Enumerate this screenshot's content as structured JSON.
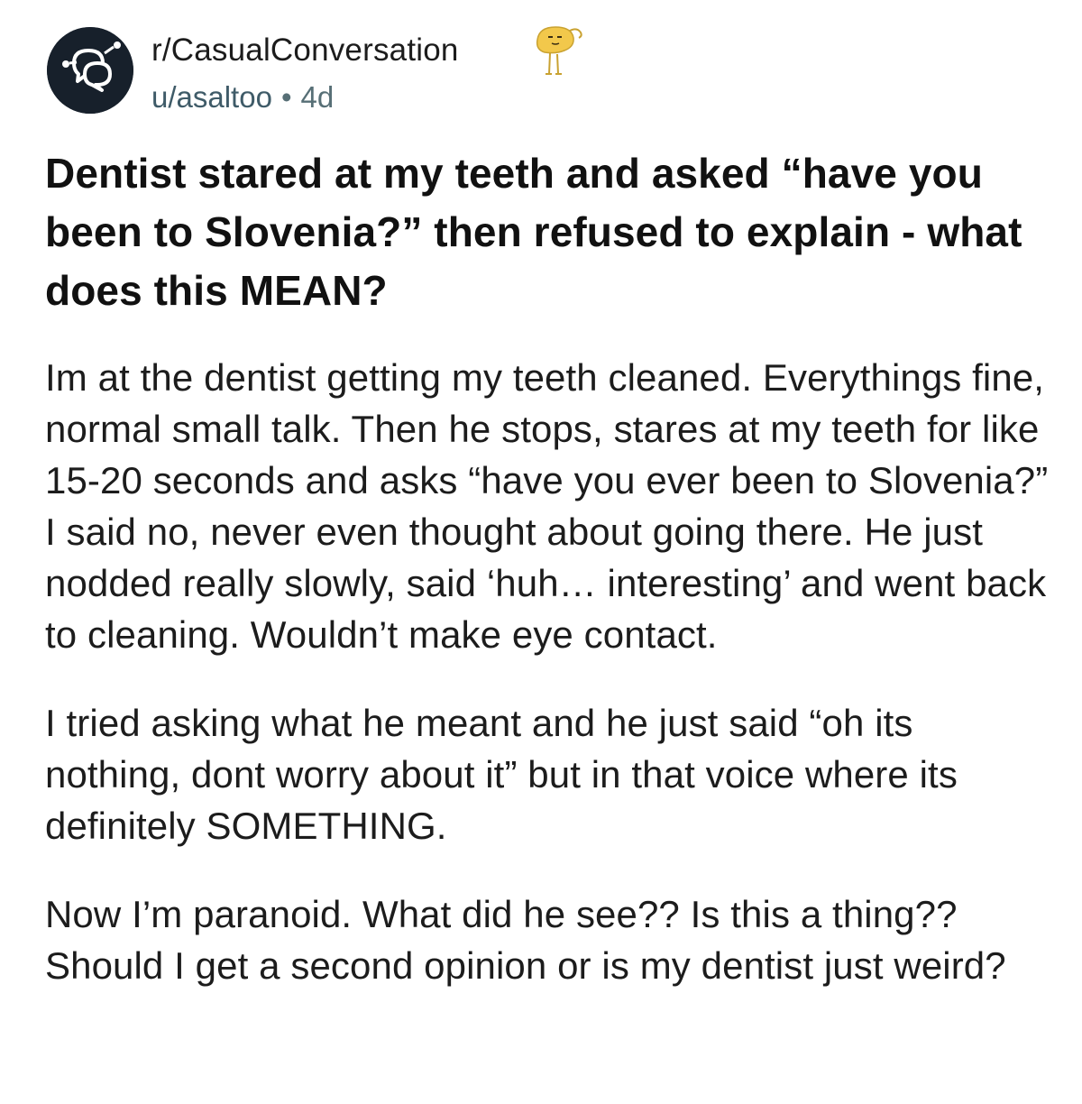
{
  "post": {
    "subreddit": "r/CasualConversation",
    "author": "u/asaltoo",
    "separator": "•",
    "age": "4d",
    "subreddit_icon": "speech-bubbles-icon",
    "award_icon": "award-mascot-icon",
    "title": "Dentist stared at my teeth and asked “have you been to Slovenia?” then refused to explain - what does this MEAN?",
    "body": [
      "Im at the dentist getting my teeth cleaned. Everythings fine, normal small talk. Then he stops, stares at my teeth for like 15-20 seconds and asks “have you ever been to Slovenia?” I said no, never even thought about going there. He just nodded really slowly, said ‘huh… interesting’ and went back to cleaning. Wouldn’t make eye contact.",
      "I tried asking what he meant and he just said “oh its nothing, dont worry about it” but in that voice where its definitely SOMETHING.",
      "Now I’m paranoid. What did he see?? Is this a thing?? Should I get a second opinion or is my dentist just weird?"
    ]
  },
  "colors": {
    "avatar_bg": "#17202b",
    "text": "#1c1c1c",
    "meta_text": "#576f76",
    "award": "#f2c84b"
  }
}
